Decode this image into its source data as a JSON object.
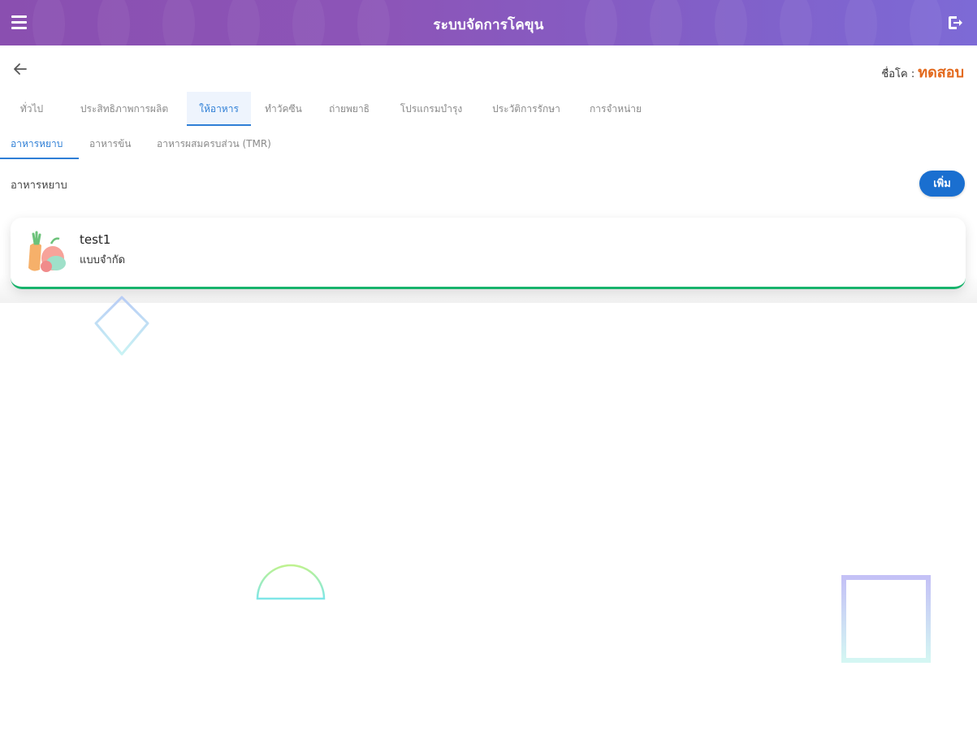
{
  "appbar": {
    "title": "ระบบจัดการโคขุน",
    "menu_icon": "menu-icon",
    "logout_icon": "logout-icon"
  },
  "header": {
    "back_icon": "arrow-left-icon",
    "cow_label": "ชื่อโค :",
    "cow_name": "ทดสอบ"
  },
  "tabs": [
    {
      "label": "ทั่วไป",
      "active": false
    },
    {
      "label": "ประสิทธิภาพการผลิต",
      "active": false
    },
    {
      "label": "ให้อาหาร",
      "active": true
    },
    {
      "label": "ทำวัคซีน",
      "active": false
    },
    {
      "label": "ถ่ายพยาธิ",
      "active": false
    },
    {
      "label": "โปรแกรมบำรุง",
      "active": false
    },
    {
      "label": "ประวัติการรักษา",
      "active": false
    },
    {
      "label": "การจำหน่าย",
      "active": false
    }
  ],
  "subtabs": [
    {
      "label": "อาหารหยาบ",
      "active": true
    },
    {
      "label": "อาหารข้น",
      "active": false
    },
    {
      "label": "อาหารผสมครบส่วน (TMR)",
      "active": false
    }
  ],
  "section": {
    "label": "อาหารหยาบ",
    "add_label": "เพิ่ม"
  },
  "items": [
    {
      "name": "test1",
      "type": "แบบจำกัด",
      "icon": "vegetables-icon"
    }
  ],
  "colors": {
    "accent": "#1a6fd0",
    "active_tab": "#2f7fd6",
    "cow_name": "#e36a1e",
    "card_border": "#18b36c"
  }
}
